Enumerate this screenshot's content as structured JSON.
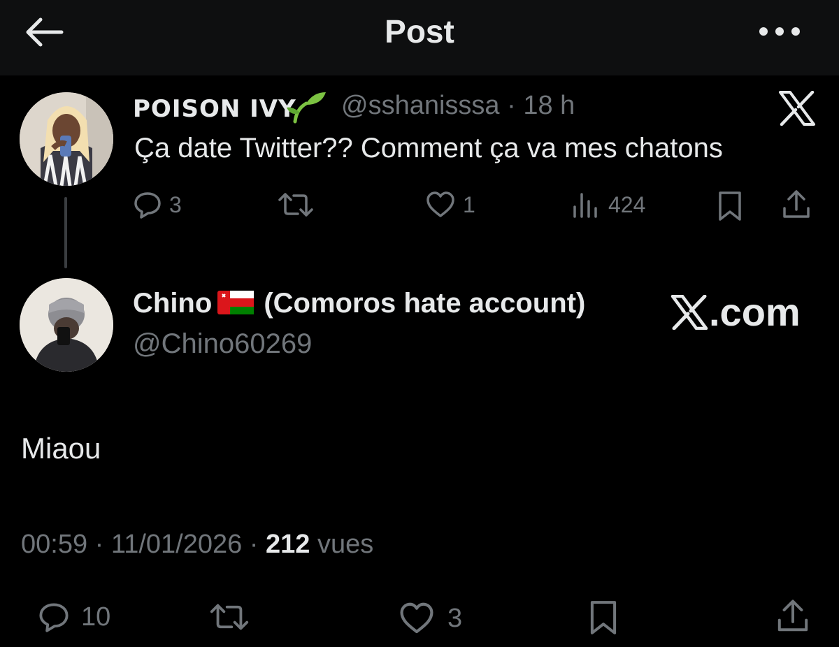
{
  "header": {
    "title": "Post",
    "back_icon": "arrow-left-icon",
    "more_icon": "more-horizontal-icon"
  },
  "parent_post": {
    "author_name": "POISON IVY",
    "author_emoji": "seedling-icon",
    "handle": "@sshanisssa",
    "time": "18 h",
    "text": "Ça date Twitter?? Comment ça va mes chatons",
    "actions": {
      "replies": "3",
      "reposts": "",
      "likes": "1",
      "views": "424"
    },
    "source_icon": "x-logo-icon"
  },
  "reply_post": {
    "author_name": "Chino",
    "author_flag": "oman-flag-icon",
    "author_suffix": "(Comoros hate account)",
    "handle": "@Chino60269",
    "text": "Miaou",
    "time": "00:59",
    "date": "11/01/2026",
    "views_count": "212",
    "views_label": "vues",
    "actions": {
      "replies": "10",
      "reposts": "",
      "likes": "3"
    }
  },
  "watermark": {
    "text": ".com",
    "logo": "x-logo-icon"
  },
  "colors": {
    "background": "#000000",
    "header_bg": "#0e0f10",
    "text_primary": "#e7e9ea",
    "text_secondary": "#71767b"
  }
}
